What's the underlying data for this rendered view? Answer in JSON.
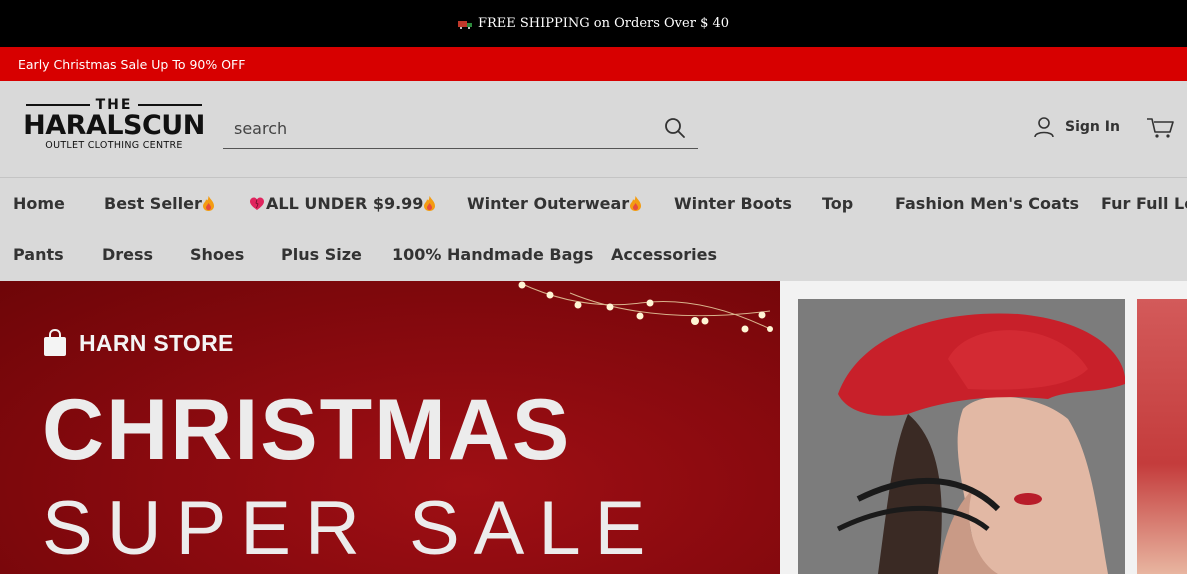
{
  "topbar": {
    "text": "FREE SHIPPING on Orders Over $ 40",
    "icon": "truck-icon"
  },
  "promobar": {
    "text": "Early Christmas Sale Up To 90% OFF"
  },
  "logo": {
    "the": "THE",
    "brand": "HARALSCUN",
    "tagline": "OUTLET CLOTHING  CENTRE"
  },
  "search": {
    "placeholder": "search",
    "value": "",
    "icon": "search-icon"
  },
  "account": {
    "signin_label": "Sign In",
    "icon": "user-icon"
  },
  "cart": {
    "icon": "cart-icon"
  },
  "nav": {
    "row1": [
      "Home",
      "Best Seller",
      "ALL UNDER $9.99",
      "Winter Outerwear",
      "Winter Boots",
      "Top",
      "Fashion Men's Coats",
      "Fur Full Ler"
    ],
    "row2": [
      "Pants",
      "Dress",
      "Shoes",
      "Plus Size",
      "100% Handmade Bags",
      "Accessories"
    ]
  },
  "hero": {
    "store_name": "HARN STORE",
    "title": "CHRISTMAS",
    "subtitle": "SUPER SALE"
  },
  "colors": {
    "topbar_bg": "#000000",
    "promo_bg": "#d70000",
    "header_bg": "#d9d9d9",
    "hero_red": "#8a0a0f"
  }
}
